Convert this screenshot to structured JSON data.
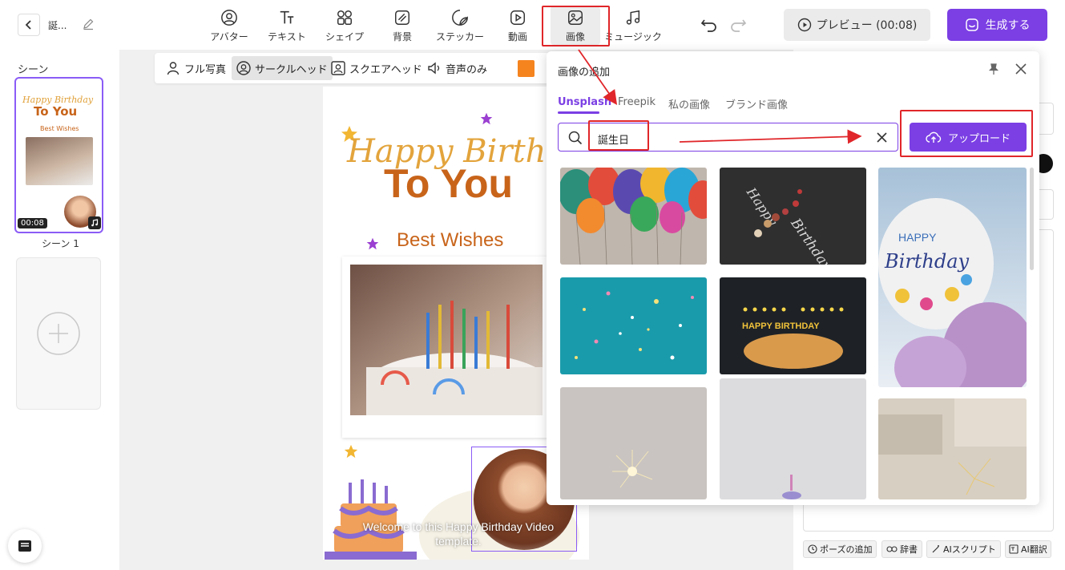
{
  "header": {
    "project_title": "誕...",
    "tools": [
      {
        "label": "アバター",
        "icon": "avatar-icon"
      },
      {
        "label": "テキスト",
        "icon": "text-icon"
      },
      {
        "label": "シェイプ",
        "icon": "shape-icon"
      },
      {
        "label": "背景",
        "icon": "background-icon"
      },
      {
        "label": "ステッカー",
        "icon": "sticker-icon"
      },
      {
        "label": "動画",
        "icon": "video-icon"
      },
      {
        "label": "画像",
        "icon": "image-icon"
      },
      {
        "label": "ミュージック",
        "icon": "music-icon"
      }
    ],
    "preview_label": "プレビュー (00:08)",
    "generate_label": "生成する"
  },
  "layout_toolbar": {
    "items": [
      "フル写真",
      "サークルヘッド",
      "スクエアヘッド",
      "音声のみ"
    ],
    "active": "サークルヘッド",
    "color": "#f5841f"
  },
  "scenes": {
    "title": "シーン",
    "scene1": {
      "label": "シーン 1",
      "duration": "00:08",
      "thumb_line1": "Happy Birthday",
      "thumb_line2": "To You",
      "thumb_line3": "Best Wishes"
    }
  },
  "canvas": {
    "headline1": "Happy Birthday",
    "headline2": "To You",
    "subtitle": "Best Wishes",
    "caption": "Welcome to this Happy Birthday Video template."
  },
  "popup": {
    "title": "画像の追加",
    "tabs": [
      "Unsplash",
      "Freepik",
      "私の画像",
      "ブランド画像"
    ],
    "active_tab": "Unsplash",
    "search_value": "誕生日",
    "upload_label": "アップロード",
    "balloon_text_1": "HAPPY",
    "balloon_text_2": "Birthday",
    "cake_text": "HAPPY BIRTHDAY",
    "chalk_text_1": "Happy",
    "chalk_text_2": "Birthday"
  },
  "right_panel": {
    "bottom_buttons": [
      "ポーズの追加",
      "辞書",
      "AIスクリプト",
      "AI翻訳"
    ]
  },
  "colors": {
    "accent": "#7b3fe4",
    "annotation_red": "#e0262a",
    "orange": "#c8641a"
  }
}
